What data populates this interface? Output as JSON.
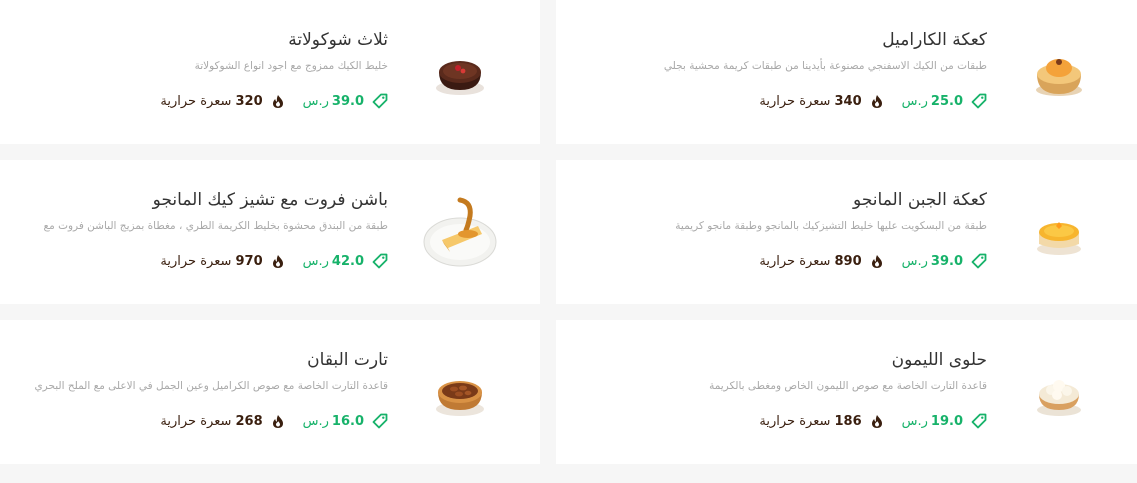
{
  "currency": "ر.س",
  "calories_label": "سعرة حرارية",
  "icons": {
    "price": "price-tag-icon",
    "calories": "flame-icon"
  },
  "colors": {
    "price": "#17b26a",
    "calories": "#3a1f0f",
    "card_bg": "#ffffff",
    "page_bg": "#f6f6f6"
  },
  "items": [
    {
      "title": "كعكة الكاراميل",
      "desc": "طبقات من الكيك الاسفنجي مصنوعة بأيدينا من طبقات كريمة محشية بجلي",
      "price": "25.0",
      "calories": "340"
    },
    {
      "title": "ثلاث شوكولاتة",
      "desc": "خليط الكيك ممزوج مع اجود انواع الشوكولاتة",
      "price": "39.0",
      "calories": "320"
    },
    {
      "title": "كعكة الجبن المانجو",
      "desc": "طبقة من البسكويت عليها خليط التشيزكيك بالمانجو وطبقة مانجو كريمية",
      "price": "39.0",
      "calories": "890"
    },
    {
      "title": "باشن فروت مع تشيز كيك المانجو",
      "desc": "طبقة من البندق محشوة بخليط الكريمة الطري ، مغطاة بمزيج الباشن فروت مع",
      "price": "42.0",
      "calories": "970"
    },
    {
      "title": "حلوى الليمون",
      "desc": "قاعدة التارت الخاصة مع صوص الليمون الخاص ومغطى بالكريمة",
      "price": "19.0",
      "calories": "186"
    },
    {
      "title": "تارت البقان",
      "desc": "قاعدة التارت الخاصة مع صوص الكراميل وعين الجمل في الاعلى مع الملح البحري",
      "price": "16.0",
      "calories": "268"
    }
  ]
}
